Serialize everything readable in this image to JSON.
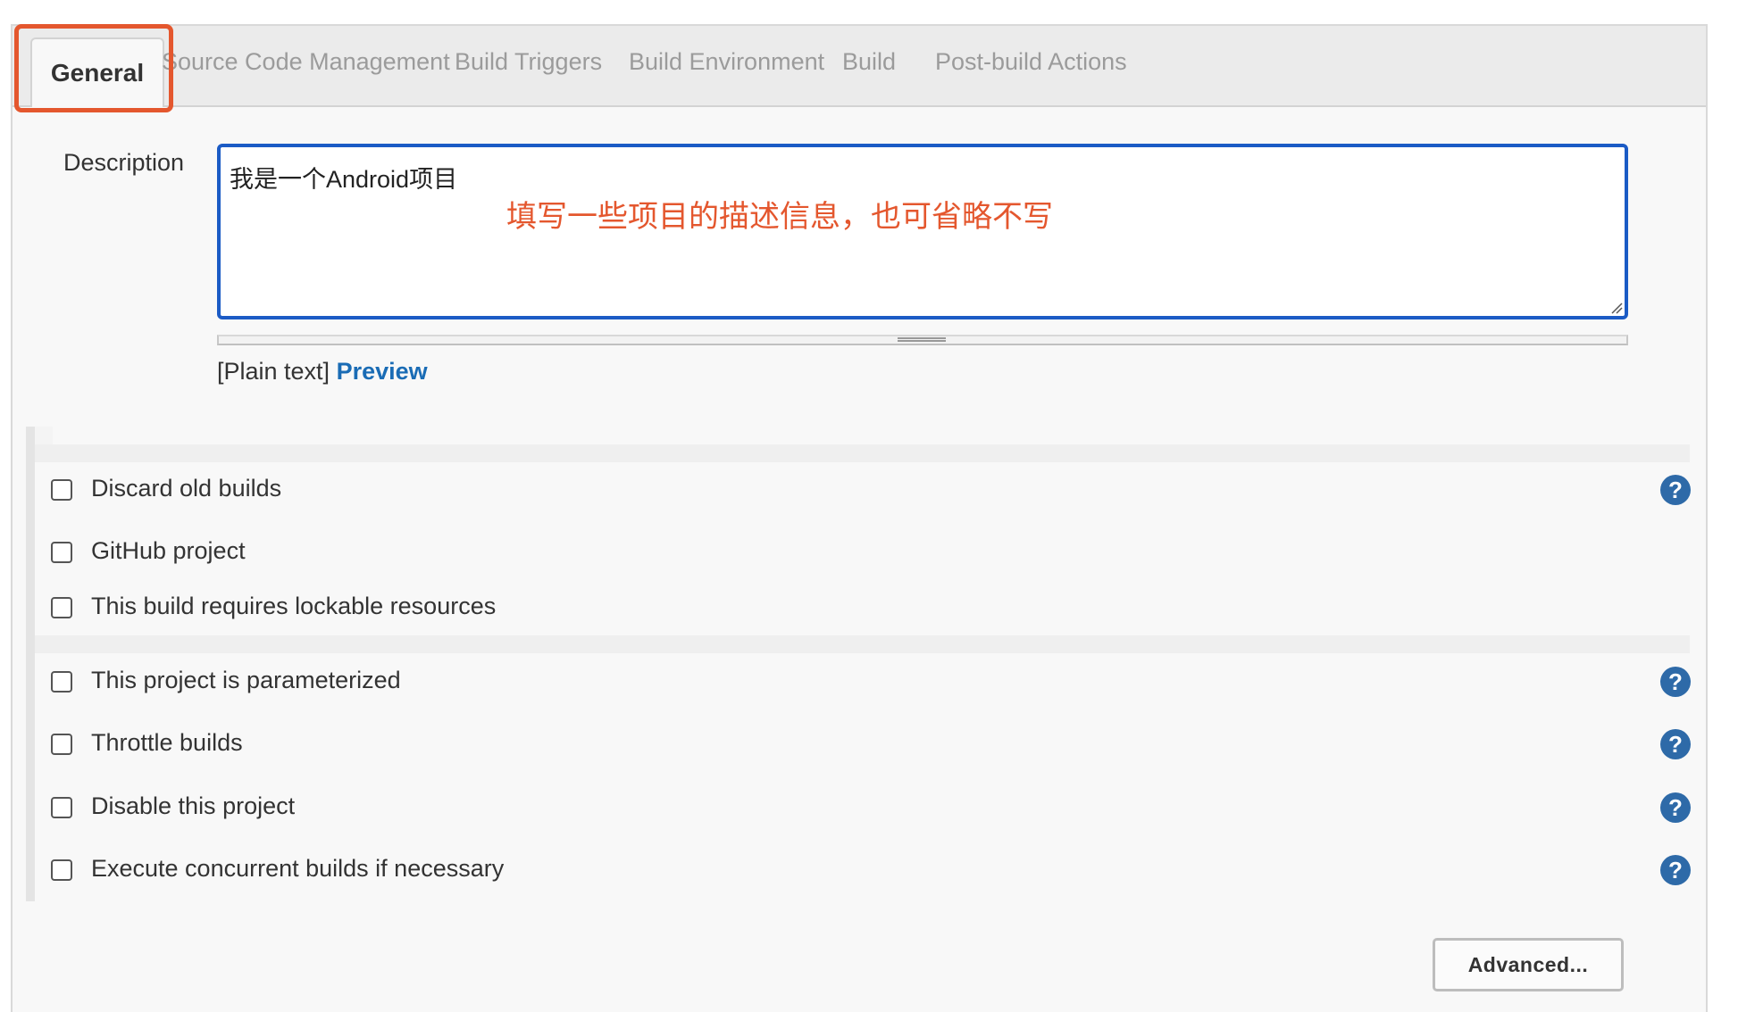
{
  "tabs": [
    {
      "label": "General",
      "active": true
    },
    {
      "label": "Source Code Management",
      "active": false
    },
    {
      "label": "Build Triggers",
      "active": false
    },
    {
      "label": "Build Environment",
      "active": false
    },
    {
      "label": "Build",
      "active": false
    },
    {
      "label": "Post-build Actions",
      "active": false
    }
  ],
  "description": {
    "label": "Description",
    "value": "我是一个Android项目",
    "annotation": "填写一些项目的描述信息，也可省略不写",
    "format_label": "[Plain text]",
    "preview_label": "Preview"
  },
  "options": [
    {
      "label": "Discard old builds",
      "checked": false,
      "help": true
    },
    {
      "label": "GitHub project",
      "checked": false,
      "help": false
    },
    {
      "label": "This build requires lockable resources",
      "checked": false,
      "help": false
    },
    {
      "label": "This project is parameterized",
      "checked": false,
      "help": true
    },
    {
      "label": "Throttle builds",
      "checked": false,
      "help": true
    },
    {
      "label": "Disable this project",
      "checked": false,
      "help": true
    },
    {
      "label": "Execute concurrent builds if necessary",
      "checked": false,
      "help": true
    }
  ],
  "help_glyph": "?",
  "advanced_label": "Advanced...",
  "colors": {
    "highlight": "#e4572e",
    "focus_border": "#1b5bc5",
    "link": "#1a6cb5",
    "help_icon": "#2e6aa8"
  }
}
